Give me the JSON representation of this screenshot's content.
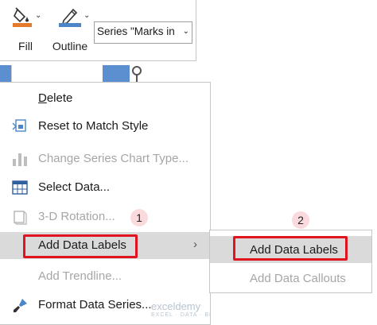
{
  "toolbar": {
    "fill_label": "Fill",
    "outline_label": "Outline",
    "series_select_value": "Series \"Marks in"
  },
  "menu": {
    "items": [
      {
        "label": "Delete",
        "underline": "D",
        "rest": "elete",
        "disabled": false
      },
      {
        "label": "Reset to Match Style",
        "disabled": false
      },
      {
        "label": "Change Series Chart Type...",
        "disabled": true
      },
      {
        "label": "Select Data...",
        "disabled": false
      },
      {
        "label": "3-D Rotation...",
        "disabled": true
      },
      {
        "label": "Add Data Labels",
        "disabled": false,
        "has_submenu": true,
        "highlighted": true
      },
      {
        "label": "Add Trendline...",
        "disabled": true
      },
      {
        "label": "Format Data Series...",
        "disabled": false
      }
    ]
  },
  "submenu": {
    "items": [
      {
        "label": "Add Data Labels",
        "disabled": false,
        "highlighted": true
      },
      {
        "label": "Add Data Callouts",
        "disabled": true
      }
    ]
  },
  "annotations": {
    "step1": "1",
    "step2": "2",
    "highlight_color": "#e0141e"
  },
  "watermark": {
    "brand": "exceldemy",
    "tagline": "EXCEL · DATA · BI"
  },
  "colors": {
    "fill_swatch": "#e57a2c",
    "outline_swatch": "#4a86c8",
    "chart_series": "#5b8fd0"
  }
}
